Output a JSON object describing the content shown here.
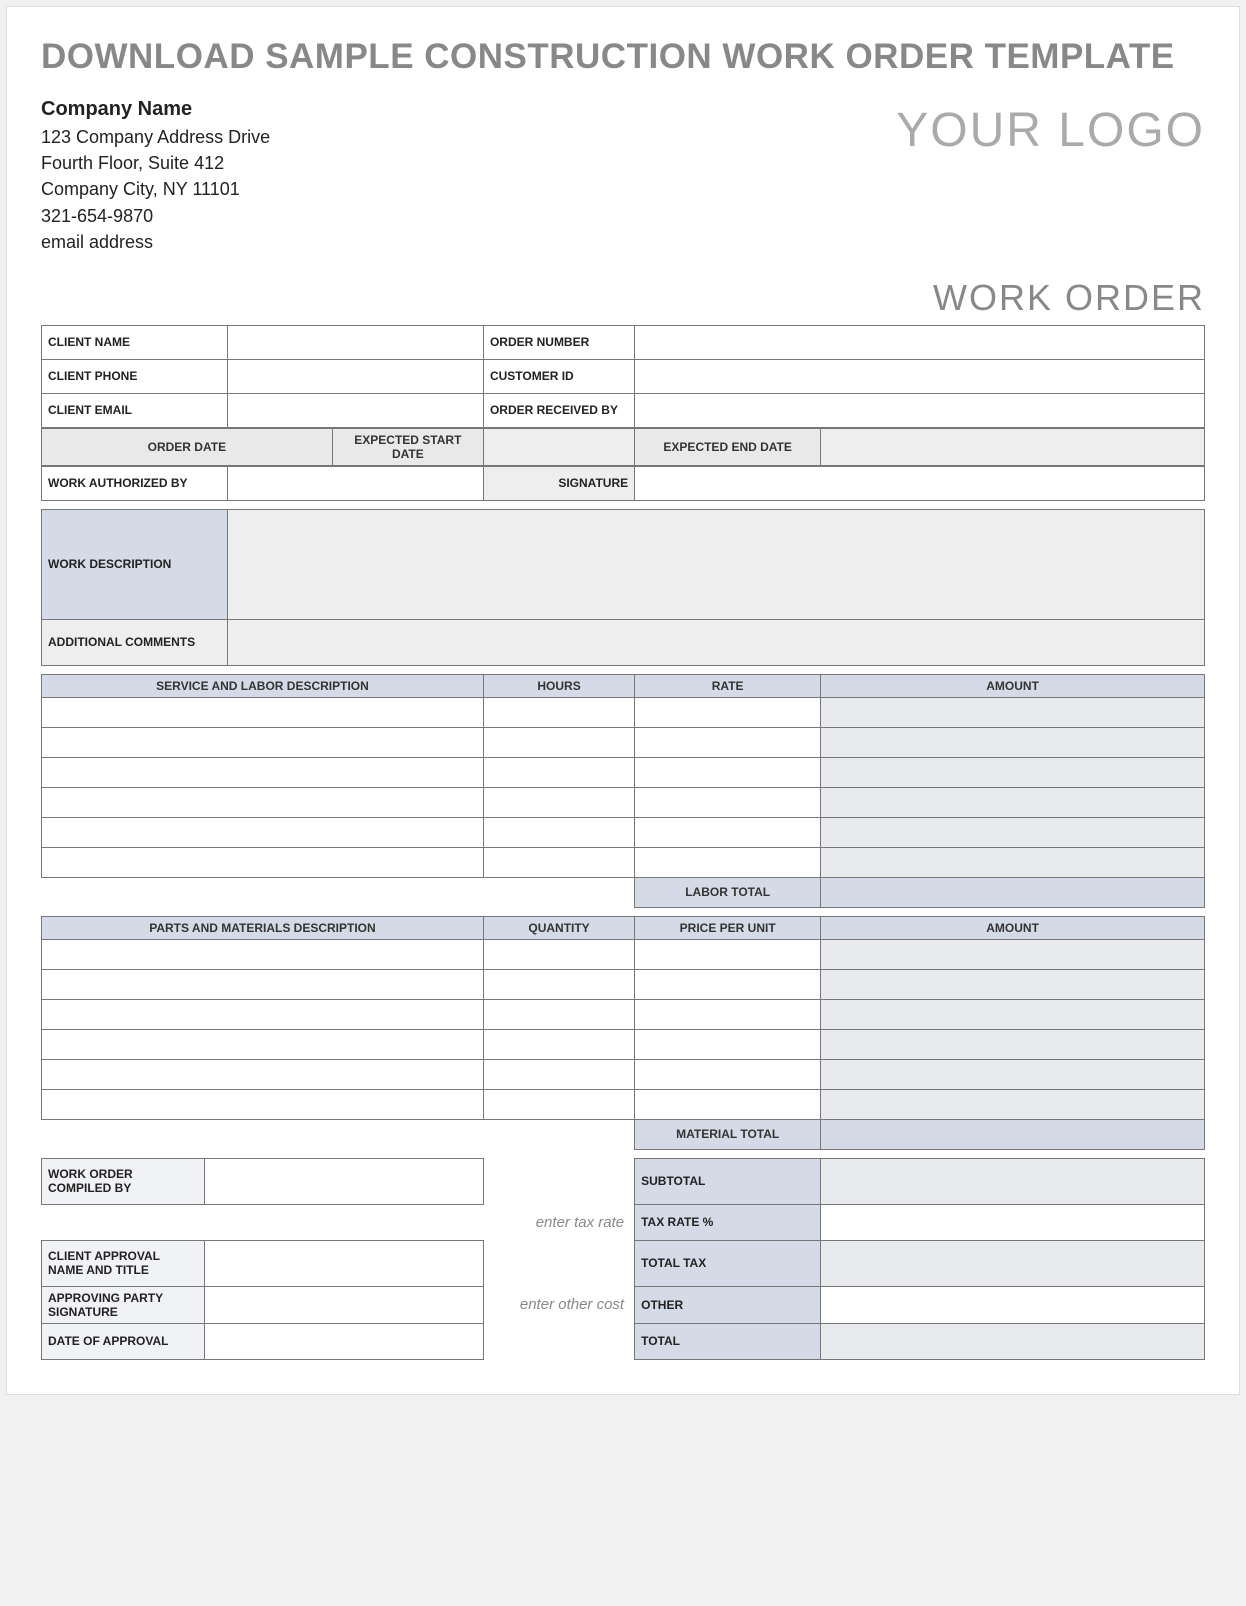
{
  "title": "DOWNLOAD SAMPLE CONSTRUCTION WORK ORDER TEMPLATE",
  "logo_text": "YOUR LOGO",
  "doc_type": "WORK ORDER",
  "company": {
    "name": "Company Name",
    "addr1": "123 Company Address Drive",
    "addr2": "Fourth Floor, Suite 412",
    "city_line": "Company City, NY  11101",
    "phone": "321-654-9870",
    "email": "email address"
  },
  "fields": {
    "client_name_lbl": "CLIENT NAME",
    "client_phone_lbl": "CLIENT PHONE",
    "client_email_lbl": "CLIENT EMAIL",
    "order_number_lbl": "ORDER NUMBER",
    "customer_id_lbl": "CUSTOMER ID",
    "order_received_by_lbl": "ORDER RECEIVED BY",
    "order_date_lbl": "ORDER DATE",
    "expected_start_lbl": "EXPECTED START DATE",
    "expected_end_lbl": "EXPECTED END DATE",
    "work_auth_lbl": "WORK AUTHORIZED BY",
    "signature_lbl": "SIGNATURE",
    "work_desc_lbl": "WORK DESCRIPTION",
    "add_comments_lbl": "ADDITIONAL COMMENTS"
  },
  "service_headers": {
    "desc": "SERVICE AND LABOR DESCRIPTION",
    "hours": "HOURS",
    "rate": "RATE",
    "amount": "AMOUNT"
  },
  "labor_total_lbl": "LABOR TOTAL",
  "parts_headers": {
    "desc": "PARTS AND MATERIALS DESCRIPTION",
    "qty": "QUANTITY",
    "ppu": "PRICE PER UNIT",
    "amount": "AMOUNT"
  },
  "material_total_lbl": "MATERIAL TOTAL",
  "bottom_left": {
    "compiled_by_lbl": "WORK ORDER COMPILED BY",
    "client_approval_lbl": "CLIENT APPROVAL NAME AND TITLE",
    "approving_sig_lbl": "APPROVING PARTY SIGNATURE",
    "date_approval_lbl": "DATE OF APPROVAL"
  },
  "hints": {
    "tax": "enter tax rate",
    "other": "enter other cost"
  },
  "totals": {
    "subtotal": "SUBTOTAL",
    "tax_rate": "TAX RATE %",
    "total_tax": "TOTAL TAX",
    "other": "OTHER",
    "total": "TOTAL"
  }
}
